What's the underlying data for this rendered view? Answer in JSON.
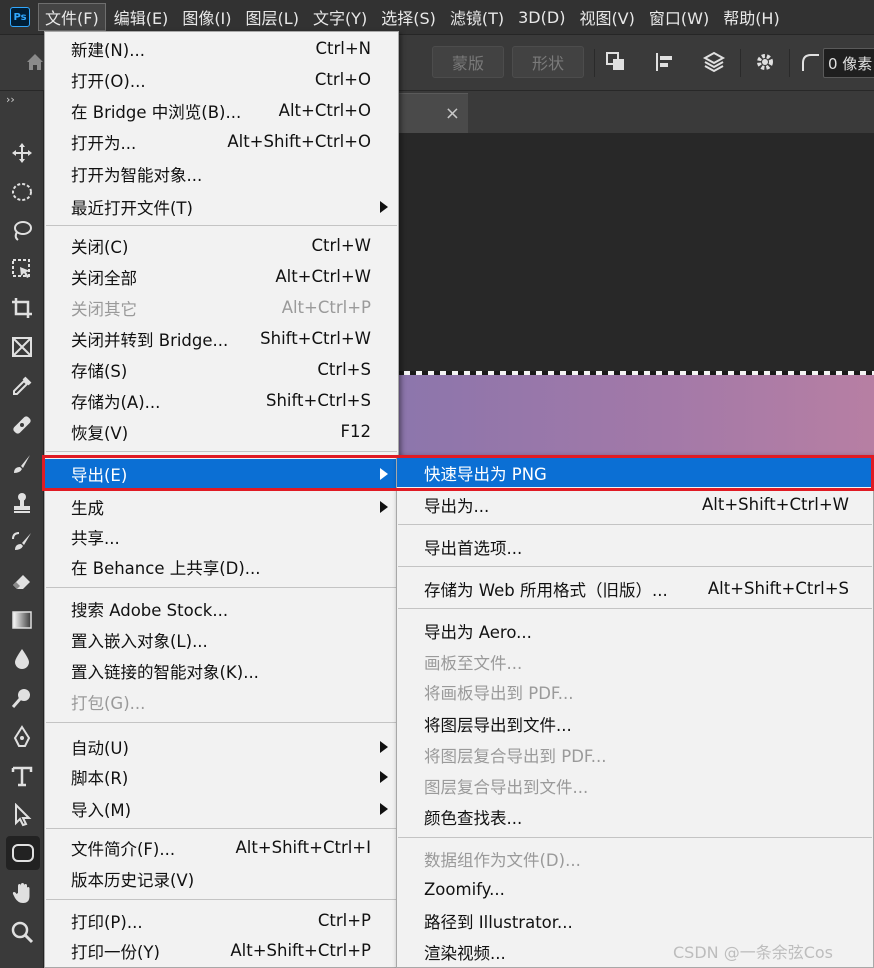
{
  "app": {
    "logo_text": "Ps"
  },
  "menubar": {
    "items": [
      "文件(F)",
      "编辑(E)",
      "图像(I)",
      "图层(L)",
      "文字(Y)",
      "选择(S)",
      "滤镜(T)",
      "3D(D)",
      "视图(V)",
      "窗口(W)",
      "帮助(H)"
    ],
    "active": "文件(F)"
  },
  "options_bar": {
    "mask_button": "蒙版",
    "shape_button": "形状",
    "radius_value": "0 像素",
    "icons": [
      "home-icon",
      "path-operations-icon",
      "path-alignment-icon",
      "path-arrangement-icon",
      "gear-icon",
      "corner-radius-icon"
    ]
  },
  "toolbar": {
    "collapse": "››",
    "tools": [
      "move-icon",
      "ellipse-marquee-icon",
      "lasso-icon",
      "object-selection-icon",
      "crop-icon",
      "frame-icon",
      "eyedropper-icon",
      "healing-brush-icon",
      "brush-icon",
      "clone-stamp-icon",
      "history-brush-icon",
      "eraser-icon",
      "gradient-icon",
      "blur-icon",
      "dodge-icon",
      "pen-icon",
      "type-icon",
      "path-selection-icon",
      "rounded-rectangle-icon",
      "hand-icon",
      "zoom-icon"
    ],
    "selected_tool": "rounded-rectangle-icon"
  },
  "document": {
    "tab_close": "×"
  },
  "file_menu": {
    "items": [
      {
        "label": "新建(N)...",
        "shortcut": "Ctrl+N"
      },
      {
        "label": "打开(O)...",
        "shortcut": "Ctrl+O"
      },
      {
        "label": "在 Bridge 中浏览(B)...",
        "shortcut": "Alt+Ctrl+O"
      },
      {
        "label": "打开为...",
        "shortcut": "Alt+Shift+Ctrl+O"
      },
      {
        "label": "打开为智能对象...",
        "shortcut": ""
      },
      {
        "label": "最近打开文件(T)",
        "shortcut": "",
        "submenu": true
      },
      {
        "label": "关闭(C)",
        "shortcut": "Ctrl+W"
      },
      {
        "label": "关闭全部",
        "shortcut": "Alt+Ctrl+W"
      },
      {
        "label": "关闭其它",
        "shortcut": "Alt+Ctrl+P",
        "disabled": true
      },
      {
        "label": "关闭并转到 Bridge...",
        "shortcut": "Shift+Ctrl+W"
      },
      {
        "label": "存储(S)",
        "shortcut": "Ctrl+S"
      },
      {
        "label": "存储为(A)...",
        "shortcut": "Shift+Ctrl+S"
      },
      {
        "label": "恢复(V)",
        "shortcut": "F12"
      },
      {
        "label": "导出(E)",
        "shortcut": "",
        "submenu": true,
        "highlighted": true
      },
      {
        "label": "生成",
        "shortcut": "",
        "submenu": true
      },
      {
        "label": "共享...",
        "shortcut": ""
      },
      {
        "label": "在 Behance 上共享(D)...",
        "shortcut": ""
      },
      {
        "label": "搜索 Adobe Stock...",
        "shortcut": ""
      },
      {
        "label": "置入嵌入对象(L)...",
        "shortcut": ""
      },
      {
        "label": "置入链接的智能对象(K)...",
        "shortcut": ""
      },
      {
        "label": "打包(G)...",
        "shortcut": "",
        "disabled": true
      },
      {
        "label": "自动(U)",
        "shortcut": "",
        "submenu": true
      },
      {
        "label": "脚本(R)",
        "shortcut": "",
        "submenu": true
      },
      {
        "label": "导入(M)",
        "shortcut": "",
        "submenu": true
      },
      {
        "label": "文件简介(F)...",
        "shortcut": "Alt+Shift+Ctrl+I"
      },
      {
        "label": "版本历史记录(V)",
        "shortcut": ""
      },
      {
        "label": "打印(P)...",
        "shortcut": "Ctrl+P"
      },
      {
        "label": "打印一份(Y)",
        "shortcut": "Alt+Shift+Ctrl+P"
      }
    ]
  },
  "export_submenu": {
    "items": [
      {
        "label": "快速导出为 PNG",
        "shortcut": "",
        "highlighted": true
      },
      {
        "label": "导出为...",
        "shortcut": "Alt+Shift+Ctrl+W"
      },
      {
        "label": "导出首选项...",
        "shortcut": ""
      },
      {
        "label": "存储为 Web 所用格式（旧版）...",
        "shortcut": "Alt+Shift+Ctrl+S"
      },
      {
        "label": "导出为 Aero...",
        "shortcut": ""
      },
      {
        "label": "画板至文件...",
        "shortcut": "",
        "disabled": true
      },
      {
        "label": "将画板导出到 PDF...",
        "shortcut": "",
        "disabled": true
      },
      {
        "label": "将图层导出到文件...",
        "shortcut": ""
      },
      {
        "label": "将图层复合导出到 PDF...",
        "shortcut": "",
        "disabled": true
      },
      {
        "label": "图层复合导出到文件...",
        "shortcut": "",
        "disabled": true
      },
      {
        "label": "颜色查找表...",
        "shortcut": ""
      },
      {
        "label": "数据组作为文件(D)...",
        "shortcut": "",
        "disabled": true
      },
      {
        "label": "Zoomify...",
        "shortcut": ""
      },
      {
        "label": "路径到 Illustrator...",
        "shortcut": ""
      },
      {
        "label": "渲染视频...",
        "shortcut": ""
      }
    ]
  },
  "watermark": "CSDN @一条余弦Cos",
  "colors": {
    "menu_bg": "#f2f2f2",
    "highlight": "#0b6fd4",
    "annotation_outline": "#e01b24",
    "app_chrome": "#323232",
    "canvas_dark": "#282828"
  }
}
